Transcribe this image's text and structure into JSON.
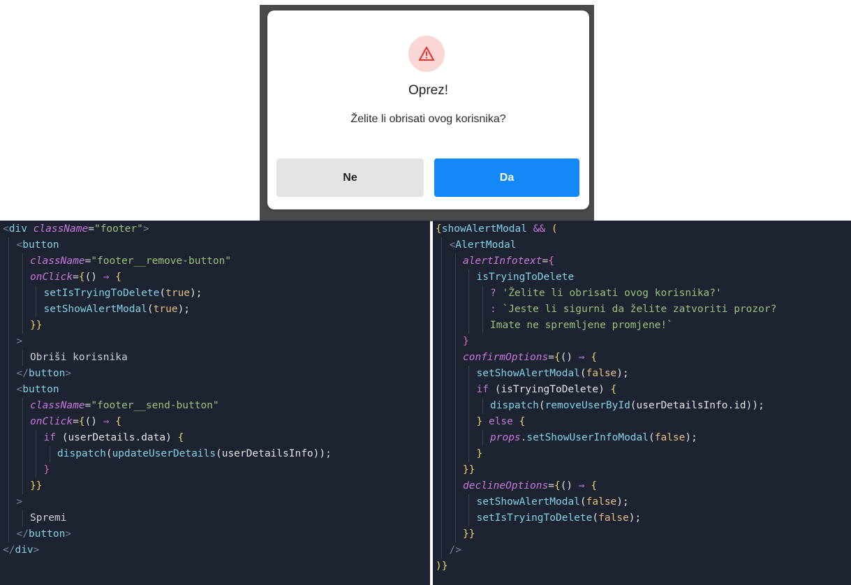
{
  "modal": {
    "icon": "warning-triangle-icon",
    "icon_glyph": "⚠",
    "icon_color": "#e53935",
    "title": "Oprez!",
    "message": "Želite li obrisati ovog korisnika?",
    "decline_label": "Ne",
    "confirm_label": "Da",
    "confirm_color": "#1388f7"
  },
  "code_left": {
    "lines": [
      {
        "indent": 0,
        "tokens": [
          {
            "t": "<",
            "c": "c-bracket"
          },
          {
            "t": "div ",
            "c": "c-tag"
          },
          {
            "t": "className",
            "c": "c-attr"
          },
          {
            "t": "=",
            "c": "c-punct"
          },
          {
            "t": "\"footer\"",
            "c": "c-str"
          },
          {
            "t": ">",
            "c": "c-bracket"
          }
        ]
      },
      {
        "indent": 1,
        "tokens": [
          {
            "t": "<",
            "c": "c-bracket"
          },
          {
            "t": "button",
            "c": "c-tag"
          }
        ]
      },
      {
        "indent": 2,
        "tokens": [
          {
            "t": "className",
            "c": "c-attr"
          },
          {
            "t": "=",
            "c": "c-punct"
          },
          {
            "t": "\"footer__remove-button\"",
            "c": "c-str"
          }
        ]
      },
      {
        "indent": 2,
        "tokens": [
          {
            "t": "onClick",
            "c": "c-attr"
          },
          {
            "t": "=",
            "c": "c-punct"
          },
          {
            "t": "{",
            "c": "c-brace"
          },
          {
            "t": "() ",
            "c": "c-paren"
          },
          {
            "t": "⇒ ",
            "c": "c-arrow"
          },
          {
            "t": "{",
            "c": "c-brace"
          }
        ]
      },
      {
        "indent": 3,
        "tokens": [
          {
            "t": "setIsTryingToDelete",
            "c": "c-fn"
          },
          {
            "t": "(",
            "c": "c-paren"
          },
          {
            "t": "true",
            "c": "c-bool"
          },
          {
            "t": ");",
            "c": "c-paren"
          }
        ]
      },
      {
        "indent": 3,
        "tokens": [
          {
            "t": "setShowAlertModal",
            "c": "c-fn"
          },
          {
            "t": "(",
            "c": "c-paren"
          },
          {
            "t": "true",
            "c": "c-bool"
          },
          {
            "t": ");",
            "c": "c-paren"
          }
        ]
      },
      {
        "indent": 2,
        "tokens": [
          {
            "t": "}}",
            "c": "c-brace"
          }
        ]
      },
      {
        "indent": 1,
        "tokens": [
          {
            "t": ">",
            "c": "c-bracket"
          }
        ]
      },
      {
        "indent": 2,
        "tokens": [
          {
            "t": "Obriši korisnika",
            "c": "c-text"
          }
        ]
      },
      {
        "indent": 1,
        "tokens": [
          {
            "t": "</",
            "c": "c-bracket"
          },
          {
            "t": "button",
            "c": "c-tag"
          },
          {
            "t": ">",
            "c": "c-bracket"
          }
        ]
      },
      {
        "indent": 1,
        "tokens": [
          {
            "t": "<",
            "c": "c-bracket"
          },
          {
            "t": "button",
            "c": "c-tag"
          }
        ]
      },
      {
        "indent": 2,
        "tokens": [
          {
            "t": "className",
            "c": "c-attr"
          },
          {
            "t": "=",
            "c": "c-punct"
          },
          {
            "t": "\"footer__send-button\"",
            "c": "c-str"
          }
        ]
      },
      {
        "indent": 2,
        "tokens": [
          {
            "t": "onClick",
            "c": "c-attr"
          },
          {
            "t": "=",
            "c": "c-punct"
          },
          {
            "t": "{",
            "c": "c-brace"
          },
          {
            "t": "() ",
            "c": "c-paren"
          },
          {
            "t": "⇒ ",
            "c": "c-arrow"
          },
          {
            "t": "{",
            "c": "c-brace"
          }
        ]
      },
      {
        "indent": 3,
        "tokens": [
          {
            "t": "if ",
            "c": "c-kw"
          },
          {
            "t": "(",
            "c": "c-paren"
          },
          {
            "t": "userDetails.data",
            "c": "c-var"
          },
          {
            "t": ") ",
            "c": "c-paren"
          },
          {
            "t": "{",
            "c": "c-brace"
          }
        ]
      },
      {
        "indent": 4,
        "tokens": [
          {
            "t": "dispatch",
            "c": "c-fn"
          },
          {
            "t": "(",
            "c": "c-paren"
          },
          {
            "t": "updateUserDetails",
            "c": "c-fn"
          },
          {
            "t": "(",
            "c": "c-paren"
          },
          {
            "t": "userDetailsInfo",
            "c": "c-var"
          },
          {
            "t": "));",
            "c": "c-paren"
          }
        ]
      },
      {
        "indent": 3,
        "tokens": [
          {
            "t": "}",
            "c": "c-brace2"
          }
        ]
      },
      {
        "indent": 2,
        "tokens": [
          {
            "t": "}}",
            "c": "c-brace"
          }
        ]
      },
      {
        "indent": 1,
        "tokens": [
          {
            "t": ">",
            "c": "c-bracket"
          }
        ]
      },
      {
        "indent": 2,
        "tokens": [
          {
            "t": "Spremi",
            "c": "c-text"
          }
        ]
      },
      {
        "indent": 1,
        "tokens": [
          {
            "t": "</",
            "c": "c-bracket"
          },
          {
            "t": "button",
            "c": "c-tag"
          },
          {
            "t": ">",
            "c": "c-bracket"
          }
        ]
      },
      {
        "indent": 0,
        "tokens": [
          {
            "t": "</",
            "c": "c-bracket"
          },
          {
            "t": "div",
            "c": "c-tag"
          },
          {
            "t": ">",
            "c": "c-bracket"
          }
        ]
      }
    ]
  },
  "code_right": {
    "lines": [
      {
        "indent": 0,
        "tokens": [
          {
            "t": "{",
            "c": "c-brace"
          },
          {
            "t": "showAlertModal ",
            "c": "c-fn"
          },
          {
            "t": "&& ",
            "c": "c-amp"
          },
          {
            "t": "(",
            "c": "c-brace"
          }
        ]
      },
      {
        "indent": 1,
        "tokens": [
          {
            "t": "<",
            "c": "c-bracket"
          },
          {
            "t": "AlertModal",
            "c": "c-tag"
          }
        ]
      },
      {
        "indent": 2,
        "tokens": [
          {
            "t": "alertInfotext",
            "c": "c-attr"
          },
          {
            "t": "=",
            "c": "c-punct"
          },
          {
            "t": "{",
            "c": "c-brace2"
          }
        ]
      },
      {
        "indent": 3,
        "tokens": [
          {
            "t": "isTryingToDelete",
            "c": "c-fn"
          }
        ]
      },
      {
        "indent": 4,
        "tokens": [
          {
            "t": "? ",
            "c": "c-amp"
          },
          {
            "t": "'Želite li obrisati ovog korisnika?'",
            "c": "c-str"
          }
        ]
      },
      {
        "indent": 4,
        "tokens": [
          {
            "t": ": ",
            "c": "c-amp"
          },
          {
            "t": "`Jeste li sigurni da želite zatvoriti prozor?",
            "c": "c-str"
          }
        ]
      },
      {
        "indent": 4,
        "tokens": [
          {
            "t": "Imate ne spremljene promjene!`",
            "c": "c-str"
          }
        ]
      },
      {
        "indent": 2,
        "tokens": [
          {
            "t": "}",
            "c": "c-brace2"
          }
        ]
      },
      {
        "indent": 2,
        "tokens": [
          {
            "t": "confirmOptions",
            "c": "c-attr"
          },
          {
            "t": "=",
            "c": "c-punct"
          },
          {
            "t": "{",
            "c": "c-brace"
          },
          {
            "t": "() ",
            "c": "c-paren"
          },
          {
            "t": "⇒ ",
            "c": "c-arrow"
          },
          {
            "t": "{",
            "c": "c-brace"
          }
        ]
      },
      {
        "indent": 3,
        "tokens": [
          {
            "t": "setShowAlertModal",
            "c": "c-fn"
          },
          {
            "t": "(",
            "c": "c-paren"
          },
          {
            "t": "false",
            "c": "c-bool"
          },
          {
            "t": ");",
            "c": "c-paren"
          }
        ]
      },
      {
        "indent": 3,
        "tokens": [
          {
            "t": "if ",
            "c": "c-kw"
          },
          {
            "t": "(",
            "c": "c-paren"
          },
          {
            "t": "isTryingToDelete",
            "c": "c-var"
          },
          {
            "t": ") ",
            "c": "c-paren"
          },
          {
            "t": "{",
            "c": "c-brace"
          }
        ]
      },
      {
        "indent": 4,
        "tokens": [
          {
            "t": "dispatch",
            "c": "c-fn"
          },
          {
            "t": "(",
            "c": "c-paren"
          },
          {
            "t": "removeUserById",
            "c": "c-fn"
          },
          {
            "t": "(",
            "c": "c-paren"
          },
          {
            "t": "userDetailsInfo.id",
            "c": "c-var"
          },
          {
            "t": "));",
            "c": "c-paren"
          }
        ]
      },
      {
        "indent": 3,
        "tokens": [
          {
            "t": "} ",
            "c": "c-brace"
          },
          {
            "t": "else ",
            "c": "c-kw"
          },
          {
            "t": "{",
            "c": "c-brace"
          }
        ]
      },
      {
        "indent": 4,
        "tokens": [
          {
            "t": "props",
            "c": "c-prop"
          },
          {
            "t": ".",
            "c": "c-punct"
          },
          {
            "t": "setShowUserInfoModal",
            "c": "c-fn"
          },
          {
            "t": "(",
            "c": "c-paren"
          },
          {
            "t": "false",
            "c": "c-bool"
          },
          {
            "t": ");",
            "c": "c-paren"
          }
        ]
      },
      {
        "indent": 3,
        "tokens": [
          {
            "t": "}",
            "c": "c-brace"
          }
        ]
      },
      {
        "indent": 2,
        "tokens": [
          {
            "t": "}}",
            "c": "c-brace"
          }
        ]
      },
      {
        "indent": 2,
        "tokens": [
          {
            "t": "declineOptions",
            "c": "c-attr"
          },
          {
            "t": "=",
            "c": "c-punct"
          },
          {
            "t": "{",
            "c": "c-brace"
          },
          {
            "t": "() ",
            "c": "c-paren"
          },
          {
            "t": "⇒ ",
            "c": "c-arrow"
          },
          {
            "t": "{",
            "c": "c-brace"
          }
        ]
      },
      {
        "indent": 3,
        "tokens": [
          {
            "t": "setShowAlertModal",
            "c": "c-fn"
          },
          {
            "t": "(",
            "c": "c-paren"
          },
          {
            "t": "false",
            "c": "c-bool"
          },
          {
            "t": ");",
            "c": "c-paren"
          }
        ]
      },
      {
        "indent": 3,
        "tokens": [
          {
            "t": "setIsTryingToDelete",
            "c": "c-fn"
          },
          {
            "t": "(",
            "c": "c-paren"
          },
          {
            "t": "false",
            "c": "c-bool"
          },
          {
            "t": ");",
            "c": "c-paren"
          }
        ]
      },
      {
        "indent": 2,
        "tokens": [
          {
            "t": "}}",
            "c": "c-brace"
          }
        ]
      },
      {
        "indent": 1,
        "tokens": [
          {
            "t": "/>",
            "c": "c-bracket"
          }
        ]
      },
      {
        "indent": 0,
        "tokens": [
          {
            "t": ")}",
            "c": "c-brace"
          }
        ]
      }
    ]
  }
}
